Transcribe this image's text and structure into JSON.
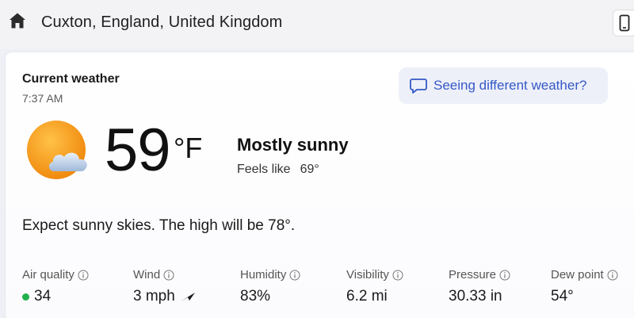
{
  "header": {
    "location": "Cuxton, England, United Kingdom",
    "home_icon": "home-icon",
    "device_icon": "phone-icon"
  },
  "current": {
    "title": "Current weather",
    "time": "7:37 AM",
    "feedback_label": "Seeing different weather?",
    "temperature": "59",
    "unit": "°F",
    "condition": "Mostly sunny",
    "feels_label": "Feels like",
    "feels_value": "69°",
    "summary": "Expect sunny skies. The high will be 78°.",
    "condition_icon": "sun-cloud-icon"
  },
  "metrics": [
    {
      "label": "Air quality",
      "value": "34",
      "indicator_color": "#21b04b"
    },
    {
      "label": "Wind",
      "value": "3 mph",
      "direction_icon": "wind-arrow-icon"
    },
    {
      "label": "Humidity",
      "value": "83%"
    },
    {
      "label": "Visibility",
      "value": "6.2 mi"
    },
    {
      "label": "Pressure",
      "value": "30.33 in"
    },
    {
      "label": "Dew point",
      "value": "54°"
    }
  ],
  "colors": {
    "accent": "#3558c7",
    "aqi_good": "#21b04b",
    "sun": "#f7a21b"
  }
}
